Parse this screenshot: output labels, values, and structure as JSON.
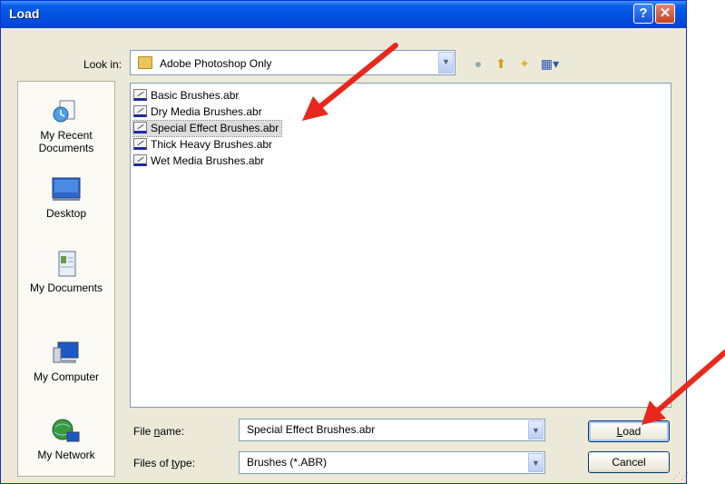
{
  "dialog": {
    "title": "Load",
    "help_label": "?",
    "close_label": "✕"
  },
  "lookin": {
    "label": "Look in:",
    "value": "Adobe Photoshop Only"
  },
  "toolbar": {
    "icons": [
      "back-icon",
      "up-folder-icon",
      "new-folder-icon",
      "view-menu-icon"
    ]
  },
  "places": [
    {
      "label": "My Recent Documents",
      "icon": "recent-documents-icon"
    },
    {
      "label": "Desktop",
      "icon": "desktop-icon"
    },
    {
      "label": "My Documents",
      "icon": "my-documents-icon"
    },
    {
      "label": "My Computer",
      "icon": "my-computer-icon"
    },
    {
      "label": "My Network",
      "icon": "my-network-icon"
    }
  ],
  "files": [
    {
      "name": "Basic Brushes.abr"
    },
    {
      "name": "Dry Media Brushes.abr"
    },
    {
      "name": "Special Effect Brushes.abr",
      "selected": true
    },
    {
      "name": "Thick Heavy Brushes.abr"
    },
    {
      "name": "Wet Media Brushes.abr"
    }
  ],
  "bottom": {
    "filename_label_pre": "File ",
    "filename_label_u": "n",
    "filename_label_post": "ame:",
    "filename_value": "Special Effect Brushes.abr",
    "filetype_label_pre": "Files of ",
    "filetype_label_u": "t",
    "filetype_label_post": "ype:",
    "filetype_value": "Brushes (*.ABR)",
    "load_u": "L",
    "load_rest": "oad",
    "cancel_label": "Cancel"
  },
  "colors": {
    "titlebar": "#0054e3",
    "dialog_bg": "#ece9d8",
    "annotation_arrow": "#e8281c"
  }
}
